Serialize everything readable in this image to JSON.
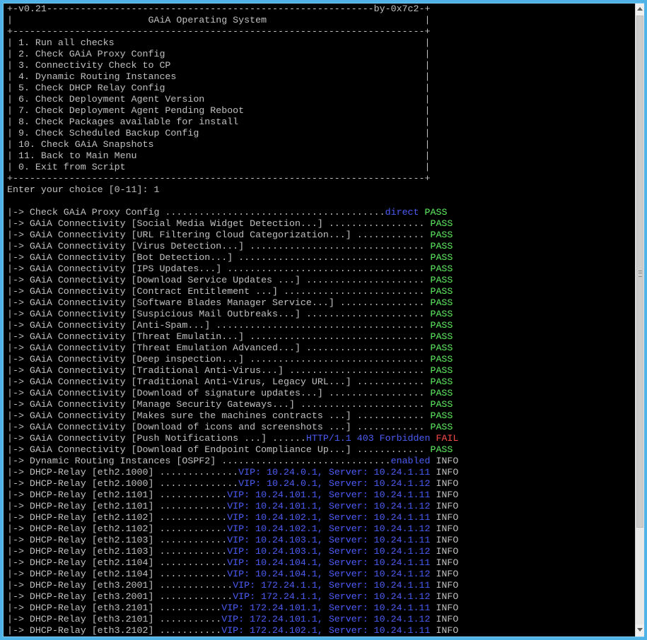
{
  "terminal": {
    "lines": [
      {
        "segments": [
          {
            "t": "+-v0.21----------------------------------------------------------by-0x7c2-+",
            "c": "white"
          }
        ]
      },
      {
        "segments": [
          {
            "t": "|                        GAiA Operating System                            |",
            "c": "white"
          }
        ]
      },
      {
        "segments": [
          {
            "t": "+-------------------------------------------------------------------------+",
            "c": "white"
          }
        ]
      },
      {
        "segments": [
          {
            "t": "| 1. Run all checks                                                       |",
            "c": "white"
          }
        ]
      },
      {
        "segments": [
          {
            "t": "| 2. Check GAiA Proxy Config                                              |",
            "c": "white"
          }
        ]
      },
      {
        "segments": [
          {
            "t": "| 3. Connectivity Check to CP                                             |",
            "c": "white"
          }
        ]
      },
      {
        "segments": [
          {
            "t": "| 4. Dynamic Routing Instances                                            |",
            "c": "white"
          }
        ]
      },
      {
        "segments": [
          {
            "t": "| 5. Check DHCP Relay Config                                              |",
            "c": "white"
          }
        ]
      },
      {
        "segments": [
          {
            "t": "| 6. Check Deployment Agent Version                                       |",
            "c": "white"
          }
        ]
      },
      {
        "segments": [
          {
            "t": "| 7. Check Deployment Agent Pending Reboot                                |",
            "c": "white"
          }
        ]
      },
      {
        "segments": [
          {
            "t": "| 8. Check Packages available for install                                 |",
            "c": "white"
          }
        ]
      },
      {
        "segments": [
          {
            "t": "| 9. Check Scheduled Backup Config                                        |",
            "c": "white"
          }
        ]
      },
      {
        "segments": [
          {
            "t": "| 10. Check GAiA Snapshots                                                |",
            "c": "white"
          }
        ]
      },
      {
        "segments": [
          {
            "t": "| 11. Back to Main Menu                                                   |",
            "c": "white"
          }
        ]
      },
      {
        "segments": [
          {
            "t": "| 0. Exit from Script                                                     |",
            "c": "white"
          }
        ]
      },
      {
        "segments": [
          {
            "t": "+-------------------------------------------------------------------------+",
            "c": "white"
          }
        ]
      },
      {
        "segments": [
          {
            "t": "Enter your choice [0-11]: 1",
            "c": "white"
          }
        ]
      },
      {
        "segments": [
          {
            "t": "",
            "c": "white"
          }
        ]
      },
      {
        "segments": [
          {
            "t": "|-> Check GAiA Proxy Config .......................................",
            "c": "white"
          },
          {
            "t": "direct",
            "c": "blue"
          },
          {
            "t": " ",
            "c": "white"
          },
          {
            "t": "PASS",
            "c": "green"
          }
        ]
      },
      {
        "segments": [
          {
            "t": "|-> GAiA Connectivity [Social Media Widget Detection...] ................. ",
            "c": "white"
          },
          {
            "t": "PASS",
            "c": "green"
          }
        ]
      },
      {
        "segments": [
          {
            "t": "|-> GAiA Connectivity [URL Filtering Cloud Categorization...] ............ ",
            "c": "white"
          },
          {
            "t": "PASS",
            "c": "green"
          }
        ]
      },
      {
        "segments": [
          {
            "t": "|-> GAiA Connectivity [Virus Detection...] ............................... ",
            "c": "white"
          },
          {
            "t": "PASS",
            "c": "green"
          }
        ]
      },
      {
        "segments": [
          {
            "t": "|-> GAiA Connectivity [Bot Detection...] ................................. ",
            "c": "white"
          },
          {
            "t": "PASS",
            "c": "green"
          }
        ]
      },
      {
        "segments": [
          {
            "t": "|-> GAiA Connectivity [IPS Updates...] ................................... ",
            "c": "white"
          },
          {
            "t": "PASS",
            "c": "green"
          }
        ]
      },
      {
        "segments": [
          {
            "t": "|-> GAiA Connectivity [Download Service Updates ...] ..................... ",
            "c": "white"
          },
          {
            "t": "PASS",
            "c": "green"
          }
        ]
      },
      {
        "segments": [
          {
            "t": "|-> GAiA Connectivity [Contract Entitlement ...] ......................... ",
            "c": "white"
          },
          {
            "t": "PASS",
            "c": "green"
          }
        ]
      },
      {
        "segments": [
          {
            "t": "|-> GAiA Connectivity [Software Blades Manager Service...] ............... ",
            "c": "white"
          },
          {
            "t": "PASS",
            "c": "green"
          }
        ]
      },
      {
        "segments": [
          {
            "t": "|-> GAiA Connectivity [Suspicious Mail Outbreaks...] ..................... ",
            "c": "white"
          },
          {
            "t": "PASS",
            "c": "green"
          }
        ]
      },
      {
        "segments": [
          {
            "t": "|-> GAiA Connectivity [Anti-Spam...] ..................................... ",
            "c": "white"
          },
          {
            "t": "PASS",
            "c": "green"
          }
        ]
      },
      {
        "segments": [
          {
            "t": "|-> GAiA Connectivity [Threat Emulatin...] ............................... ",
            "c": "white"
          },
          {
            "t": "PASS",
            "c": "green"
          }
        ]
      },
      {
        "segments": [
          {
            "t": "|-> GAiA Connectivity [Threat Emulation Advanced...] ..................... ",
            "c": "white"
          },
          {
            "t": "PASS",
            "c": "green"
          }
        ]
      },
      {
        "segments": [
          {
            "t": "|-> GAiA Connectivity [Deep inspection...] ............................... ",
            "c": "white"
          },
          {
            "t": "PASS",
            "c": "green"
          }
        ]
      },
      {
        "segments": [
          {
            "t": "|-> GAiA Connectivity [Traditional Anti-Virus...] ........................ ",
            "c": "white"
          },
          {
            "t": "PASS",
            "c": "green"
          }
        ]
      },
      {
        "segments": [
          {
            "t": "|-> GAiA Connectivity [Traditional Anti-Virus, Legacy URL...] ............ ",
            "c": "white"
          },
          {
            "t": "PASS",
            "c": "green"
          }
        ]
      },
      {
        "segments": [
          {
            "t": "|-> GAiA Connectivity [Download of signature updates...] ................. ",
            "c": "white"
          },
          {
            "t": "PASS",
            "c": "green"
          }
        ]
      },
      {
        "segments": [
          {
            "t": "|-> GAiA Connectivity [Manage Security Gateways...] ...................... ",
            "c": "white"
          },
          {
            "t": "PASS",
            "c": "green"
          }
        ]
      },
      {
        "segments": [
          {
            "t": "|-> GAiA Connectivity [Makes sure the machines contracts ...] ............ ",
            "c": "white"
          },
          {
            "t": "PASS",
            "c": "green"
          }
        ]
      },
      {
        "segments": [
          {
            "t": "|-> GAiA Connectivity [Download of icons and screenshots ...] ............ ",
            "c": "white"
          },
          {
            "t": "PASS",
            "c": "green"
          }
        ]
      },
      {
        "segments": [
          {
            "t": "|-> GAiA Connectivity [Push Notifications ...] ......",
            "c": "white"
          },
          {
            "t": "HTTP/1.1 403 Forbidden",
            "c": "blue"
          },
          {
            "t": " ",
            "c": "white"
          },
          {
            "t": "FAIL",
            "c": "red"
          }
        ]
      },
      {
        "segments": [
          {
            "t": "|-> GAiA Connectivity [Download of Endpoint Compliance Up...] ............ ",
            "c": "white"
          },
          {
            "t": "PASS",
            "c": "green"
          }
        ]
      },
      {
        "segments": [
          {
            "t": "|-> Dynamic Routing Instances [OSPF2] ..............................",
            "c": "white"
          },
          {
            "t": "enabled",
            "c": "blue"
          },
          {
            "t": " INFO",
            "c": "white"
          }
        ]
      },
      {
        "segments": [
          {
            "t": "|-> DHCP-Relay [eth2.1000] ..............",
            "c": "white"
          },
          {
            "t": "VIP: 10.24.0.1, Server: 10.24.1.11",
            "c": "blue"
          },
          {
            "t": " INFO",
            "c": "white"
          }
        ]
      },
      {
        "segments": [
          {
            "t": "|-> DHCP-Relay [eth2.1000] ..............",
            "c": "white"
          },
          {
            "t": "VIP: 10.24.0.1, Server: 10.24.1.12",
            "c": "blue"
          },
          {
            "t": " INFO",
            "c": "white"
          }
        ]
      },
      {
        "segments": [
          {
            "t": "|-> DHCP-Relay [eth2.1101] ............",
            "c": "white"
          },
          {
            "t": "VIP: 10.24.101.1, Server: 10.24.1.11",
            "c": "blue"
          },
          {
            "t": " INFO",
            "c": "white"
          }
        ]
      },
      {
        "segments": [
          {
            "t": "|-> DHCP-Relay [eth2.1101] ............",
            "c": "white"
          },
          {
            "t": "VIP: 10.24.101.1, Server: 10.24.1.12",
            "c": "blue"
          },
          {
            "t": " INFO",
            "c": "white"
          }
        ]
      },
      {
        "segments": [
          {
            "t": "|-> DHCP-Relay [eth2.1102] ............",
            "c": "white"
          },
          {
            "t": "VIP: 10.24.102.1, Server: 10.24.1.11",
            "c": "blue"
          },
          {
            "t": " INFO",
            "c": "white"
          }
        ]
      },
      {
        "segments": [
          {
            "t": "|-> DHCP-Relay [eth2.1102] ............",
            "c": "white"
          },
          {
            "t": "VIP: 10.24.102.1, Server: 10.24.1.12",
            "c": "blue"
          },
          {
            "t": " INFO",
            "c": "white"
          }
        ]
      },
      {
        "segments": [
          {
            "t": "|-> DHCP-Relay [eth2.1103] ............",
            "c": "white"
          },
          {
            "t": "VIP: 10.24.103.1, Server: 10.24.1.11",
            "c": "blue"
          },
          {
            "t": " INFO",
            "c": "white"
          }
        ]
      },
      {
        "segments": [
          {
            "t": "|-> DHCP-Relay [eth2.1103] ............",
            "c": "white"
          },
          {
            "t": "VIP: 10.24.103.1, Server: 10.24.1.12",
            "c": "blue"
          },
          {
            "t": " INFO",
            "c": "white"
          }
        ]
      },
      {
        "segments": [
          {
            "t": "|-> DHCP-Relay [eth2.1104] ............",
            "c": "white"
          },
          {
            "t": "VIP: 10.24.104.1, Server: 10.24.1.11",
            "c": "blue"
          },
          {
            "t": " INFO",
            "c": "white"
          }
        ]
      },
      {
        "segments": [
          {
            "t": "|-> DHCP-Relay [eth2.1104] ............",
            "c": "white"
          },
          {
            "t": "VIP: 10.24.104.1, Server: 10.24.1.12",
            "c": "blue"
          },
          {
            "t": " INFO",
            "c": "white"
          }
        ]
      },
      {
        "segments": [
          {
            "t": "|-> DHCP-Relay [eth3.2001] .............",
            "c": "white"
          },
          {
            "t": "VIP: 172.24.1.1, Server: 10.24.1.11",
            "c": "blue"
          },
          {
            "t": " INFO",
            "c": "white"
          }
        ]
      },
      {
        "segments": [
          {
            "t": "|-> DHCP-Relay [eth3.2001] .............",
            "c": "white"
          },
          {
            "t": "VIP: 172.24.1.1, Server: 10.24.1.12",
            "c": "blue"
          },
          {
            "t": " INFO",
            "c": "white"
          }
        ]
      },
      {
        "segments": [
          {
            "t": "|-> DHCP-Relay [eth3.2101] ...........",
            "c": "white"
          },
          {
            "t": "VIP: 172.24.101.1, Server: 10.24.1.11",
            "c": "blue"
          },
          {
            "t": " INFO",
            "c": "white"
          }
        ]
      },
      {
        "segments": [
          {
            "t": "|-> DHCP-Relay [eth3.2101] ...........",
            "c": "white"
          },
          {
            "t": "VIP: 172.24.101.1, Server: 10.24.1.12",
            "c": "blue"
          },
          {
            "t": " INFO",
            "c": "white"
          }
        ]
      },
      {
        "segments": [
          {
            "t": "|-> DHCP-Relay [eth3.2102] ...........",
            "c": "white"
          },
          {
            "t": "VIP: 172.24.102.1, Server: 10.24.1.11",
            "c": "blue"
          },
          {
            "t": " INFO",
            "c": "white"
          }
        ]
      }
    ]
  },
  "colors": {
    "background": "#000000",
    "text": "#c0c0c0",
    "value_blue": "#4a5cf5",
    "pass_green": "#5ef05e",
    "fail_red": "#ff4a4a",
    "window_border": "#7ccaf0"
  },
  "scrollbar": {
    "up_icon": "arrow-up-icon",
    "down_icon": "arrow-down-icon"
  }
}
